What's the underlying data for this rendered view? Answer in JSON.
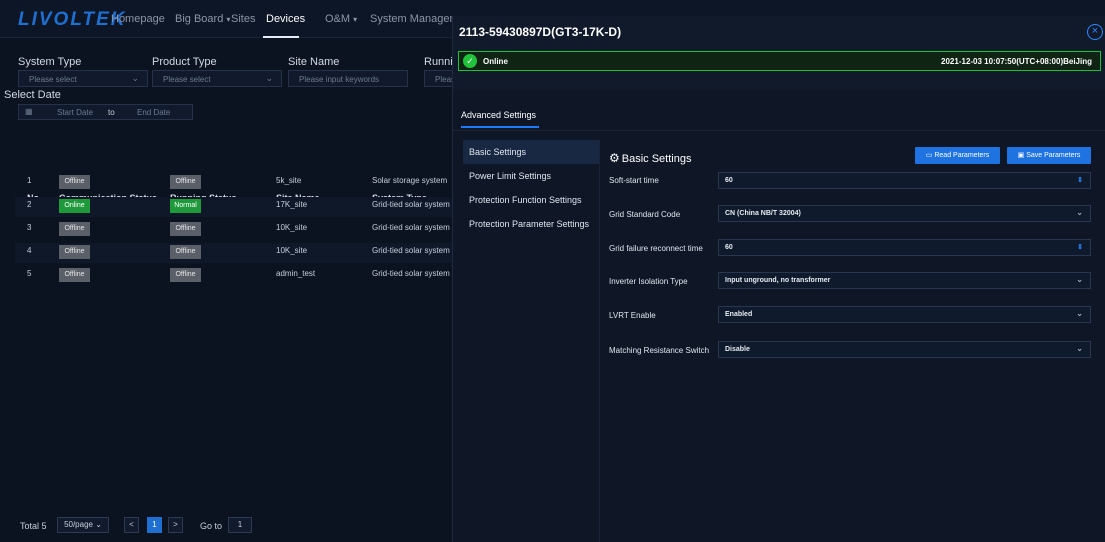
{
  "app": {
    "logo": "LIVOLTEK"
  },
  "nav": {
    "items": [
      "Homepage",
      "Big Board",
      "Sites",
      "Devices",
      "O&M",
      "System Manageme"
    ],
    "active": "Devices"
  },
  "filters": {
    "system_type": {
      "label": "System Type",
      "placeholder": "Please select"
    },
    "product_type": {
      "label": "Product Type",
      "placeholder": "Please select"
    },
    "site_name": {
      "label": "Site Name",
      "placeholder": "Please input keywords"
    },
    "running": {
      "label": "Runnin",
      "placeholder": "Pleas"
    },
    "select_date": {
      "label": "Select Date",
      "start": "Start Date",
      "to": "to",
      "end": "End Date"
    }
  },
  "table": {
    "headers": [
      "No.",
      "Communication Status",
      "Running Status",
      "Site Name",
      "System Type"
    ],
    "rows": [
      {
        "no": "1",
        "comm": "Offline",
        "run": "Offline",
        "site": "5k_site",
        "type": "Solar storage system"
      },
      {
        "no": "2",
        "comm": "Online",
        "run": "Normal",
        "site": "17K_site",
        "type": "Grid-tied solar system"
      },
      {
        "no": "3",
        "comm": "Offline",
        "run": "Offline",
        "site": "10K_site",
        "type": "Grid-tied solar system"
      },
      {
        "no": "4",
        "comm": "Offline",
        "run": "Offline",
        "site": "10K_site",
        "type": "Grid-tied solar system"
      },
      {
        "no": "5",
        "comm": "Offline",
        "run": "Offline",
        "site": "admin_test",
        "type": "Grid-tied solar system"
      }
    ]
  },
  "pager": {
    "total": "Total 5",
    "page_size": "50/page",
    "prev": "<",
    "current": "1",
    "next": ">",
    "goto_label": "Go to",
    "goto_value": "1"
  },
  "drawer": {
    "title": "2113-59430897D(GT3-17K-D)",
    "close_glyph": "×",
    "status": {
      "icon": "✓",
      "text": "Online",
      "time": "2021-12-03 10:07:50(UTC+08:00)BeiJing"
    },
    "tab": "Advanced Settings",
    "menu": [
      "Basic Settings",
      "Power Limit Settings",
      "Protection Function Settings",
      "Protection Parameter Settings"
    ],
    "section_title": "Basic Settings",
    "buttons": {
      "read": "Read Parameters",
      "save": "Save Parameters"
    },
    "params": [
      {
        "label": "Soft-start time",
        "value": "60",
        "kind": "number"
      },
      {
        "label": "Grid Standard Code",
        "value": "CN (China NB/T 32004)",
        "kind": "select"
      },
      {
        "label": "Grid failure reconnect time",
        "value": "60",
        "kind": "number"
      },
      {
        "label": "Inverter Isolation Type",
        "value": "Input unground, no transformer",
        "kind": "select"
      },
      {
        "label": "LVRT Enable",
        "value": "Enabled",
        "kind": "select"
      },
      {
        "label": "Matching Resistance Switch",
        "value": "Disable",
        "kind": "select"
      }
    ]
  },
  "icons": {
    "calendar": "📅",
    "gear": "⚙",
    "folder": "🗀",
    "save": "🖫",
    "spin": "⇕",
    "chevron": "⌄"
  }
}
